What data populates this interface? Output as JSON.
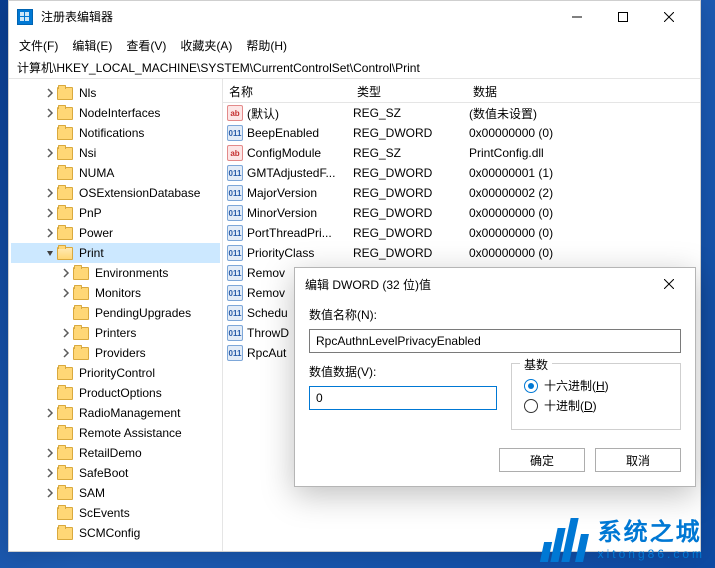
{
  "window": {
    "title": "注册表编辑器"
  },
  "menu": {
    "file": "文件(F)",
    "edit": "编辑(E)",
    "view": "查看(V)",
    "fav": "收藏夹(A)",
    "help": "帮助(H)"
  },
  "address": "计算机\\HKEY_LOCAL_MACHINE\\SYSTEM\\CurrentControlSet\\Control\\Print",
  "tree": [
    {
      "l": "Nls",
      "d": 2,
      "e": 1
    },
    {
      "l": "NodeInterfaces",
      "d": 2,
      "e": 1
    },
    {
      "l": "Notifications",
      "d": 2,
      "e": 0
    },
    {
      "l": "Nsi",
      "d": 2,
      "e": 1
    },
    {
      "l": "NUMA",
      "d": 2,
      "e": 0
    },
    {
      "l": "OSExtensionDatabase",
      "d": 2,
      "e": 1
    },
    {
      "l": "PnP",
      "d": 2,
      "e": 1
    },
    {
      "l": "Power",
      "d": 2,
      "e": 1
    },
    {
      "l": "Print",
      "d": 2,
      "e": 1,
      "open": 1,
      "sel": 1
    },
    {
      "l": "Environments",
      "d": 3,
      "e": 1
    },
    {
      "l": "Monitors",
      "d": 3,
      "e": 1
    },
    {
      "l": "PendingUpgrades",
      "d": 3,
      "e": 0
    },
    {
      "l": "Printers",
      "d": 3,
      "e": 1
    },
    {
      "l": "Providers",
      "d": 3,
      "e": 1
    },
    {
      "l": "PriorityControl",
      "d": 2,
      "e": 0
    },
    {
      "l": "ProductOptions",
      "d": 2,
      "e": 0
    },
    {
      "l": "RadioManagement",
      "d": 2,
      "e": 1
    },
    {
      "l": "Remote Assistance",
      "d": 2,
      "e": 0
    },
    {
      "l": "RetailDemo",
      "d": 2,
      "e": 1
    },
    {
      "l": "SafeBoot",
      "d": 2,
      "e": 1
    },
    {
      "l": "SAM",
      "d": 2,
      "e": 1
    },
    {
      "l": "ScEvents",
      "d": 2,
      "e": 0
    },
    {
      "l": "SCMConfig",
      "d": 2,
      "e": 0
    }
  ],
  "columns": {
    "name": "名称",
    "type": "类型",
    "data": "数据"
  },
  "values": [
    {
      "n": "(默认)",
      "t": "REG_SZ",
      "d": "(数值未设置)",
      "k": "sz"
    },
    {
      "n": "BeepEnabled",
      "t": "REG_DWORD",
      "d": "0x00000000 (0)",
      "k": "dw"
    },
    {
      "n": "ConfigModule",
      "t": "REG_SZ",
      "d": "PrintConfig.dll",
      "k": "sz"
    },
    {
      "n": "GMTAdjustedF...",
      "t": "REG_DWORD",
      "d": "0x00000001 (1)",
      "k": "dw"
    },
    {
      "n": "MajorVersion",
      "t": "REG_DWORD",
      "d": "0x00000002 (2)",
      "k": "dw"
    },
    {
      "n": "MinorVersion",
      "t": "REG_DWORD",
      "d": "0x00000000 (0)",
      "k": "dw"
    },
    {
      "n": "PortThreadPri...",
      "t": "REG_DWORD",
      "d": "0x00000000 (0)",
      "k": "dw"
    },
    {
      "n": "PriorityClass",
      "t": "REG_DWORD",
      "d": "0x00000000 (0)",
      "k": "dw"
    },
    {
      "n": "Remov",
      "t": "",
      "d": "",
      "k": "dw"
    },
    {
      "n": "Remov",
      "t": "",
      "d": "",
      "k": "dw"
    },
    {
      "n": "Schedu",
      "t": "",
      "d": "",
      "k": "dw"
    },
    {
      "n": "ThrowD",
      "t": "",
      "d": "",
      "k": "dw"
    },
    {
      "n": "RpcAut",
      "t": "",
      "d": "",
      "k": "dw"
    }
  ],
  "dialog": {
    "title": "编辑 DWORD (32 位)值",
    "name_label": "数值名称(N):",
    "name_value": "RpcAuthnLevelPrivacyEnabled",
    "data_label": "数值数据(V):",
    "data_value": "0",
    "base_label": "基数",
    "hex": "十六进制(H)",
    "dec": "十进制(D)",
    "ok": "确定",
    "cancel": "取消"
  },
  "watermark": {
    "l1": "系统之城",
    "l2": "xitong86.com"
  }
}
